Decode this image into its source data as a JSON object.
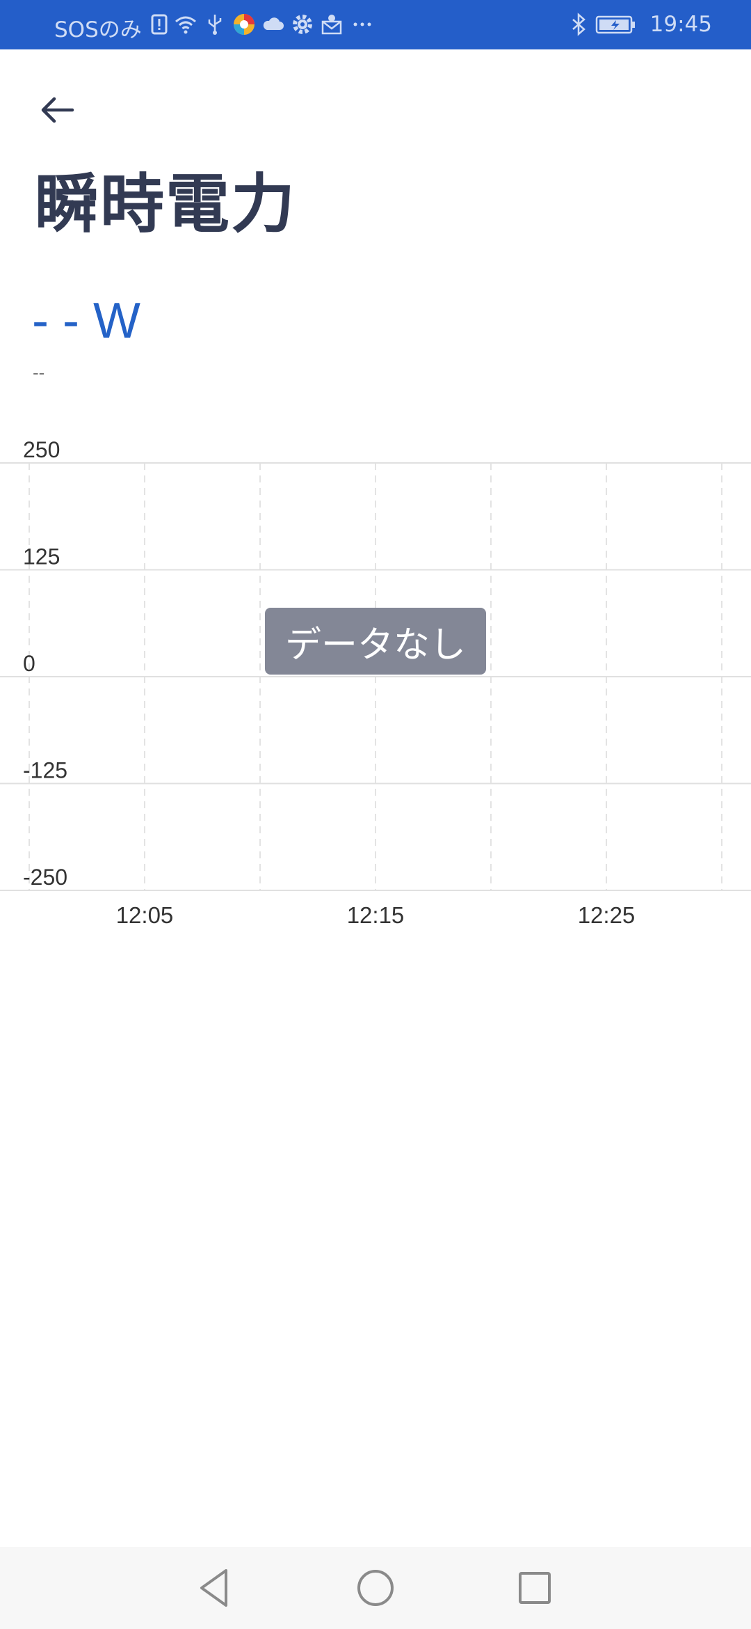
{
  "status_bar": {
    "carrier": "SOSのみ",
    "time": "19:45",
    "icons": [
      "sim-alert-icon",
      "wifi-icon",
      "usb-icon",
      "browser-icon",
      "cloud-icon",
      "gear-icon",
      "mail-icon",
      "more-icon",
      "bluetooth-icon",
      "battery-icon"
    ]
  },
  "header": {
    "back_icon": "arrow-left-icon",
    "title": "瞬時電力"
  },
  "reading": {
    "value": "- - W",
    "timestamp": "--"
  },
  "chart_data": {
    "type": "line",
    "x_ticks": [
      "12:05",
      "12:15",
      "12:25"
    ],
    "y_ticks": [
      "250",
      "125",
      "0",
      "-125",
      "-250"
    ],
    "ylim": [
      -250,
      250
    ],
    "grid": true,
    "series": [],
    "empty_message": "データなし"
  },
  "nav_bar": {
    "buttons": [
      "back-triangle-icon",
      "home-circle-icon",
      "recents-square-icon"
    ]
  },
  "colors": {
    "status_bar": "#245ec9",
    "accent": "#2462c7",
    "title": "#323a53",
    "badge": "#838796"
  }
}
